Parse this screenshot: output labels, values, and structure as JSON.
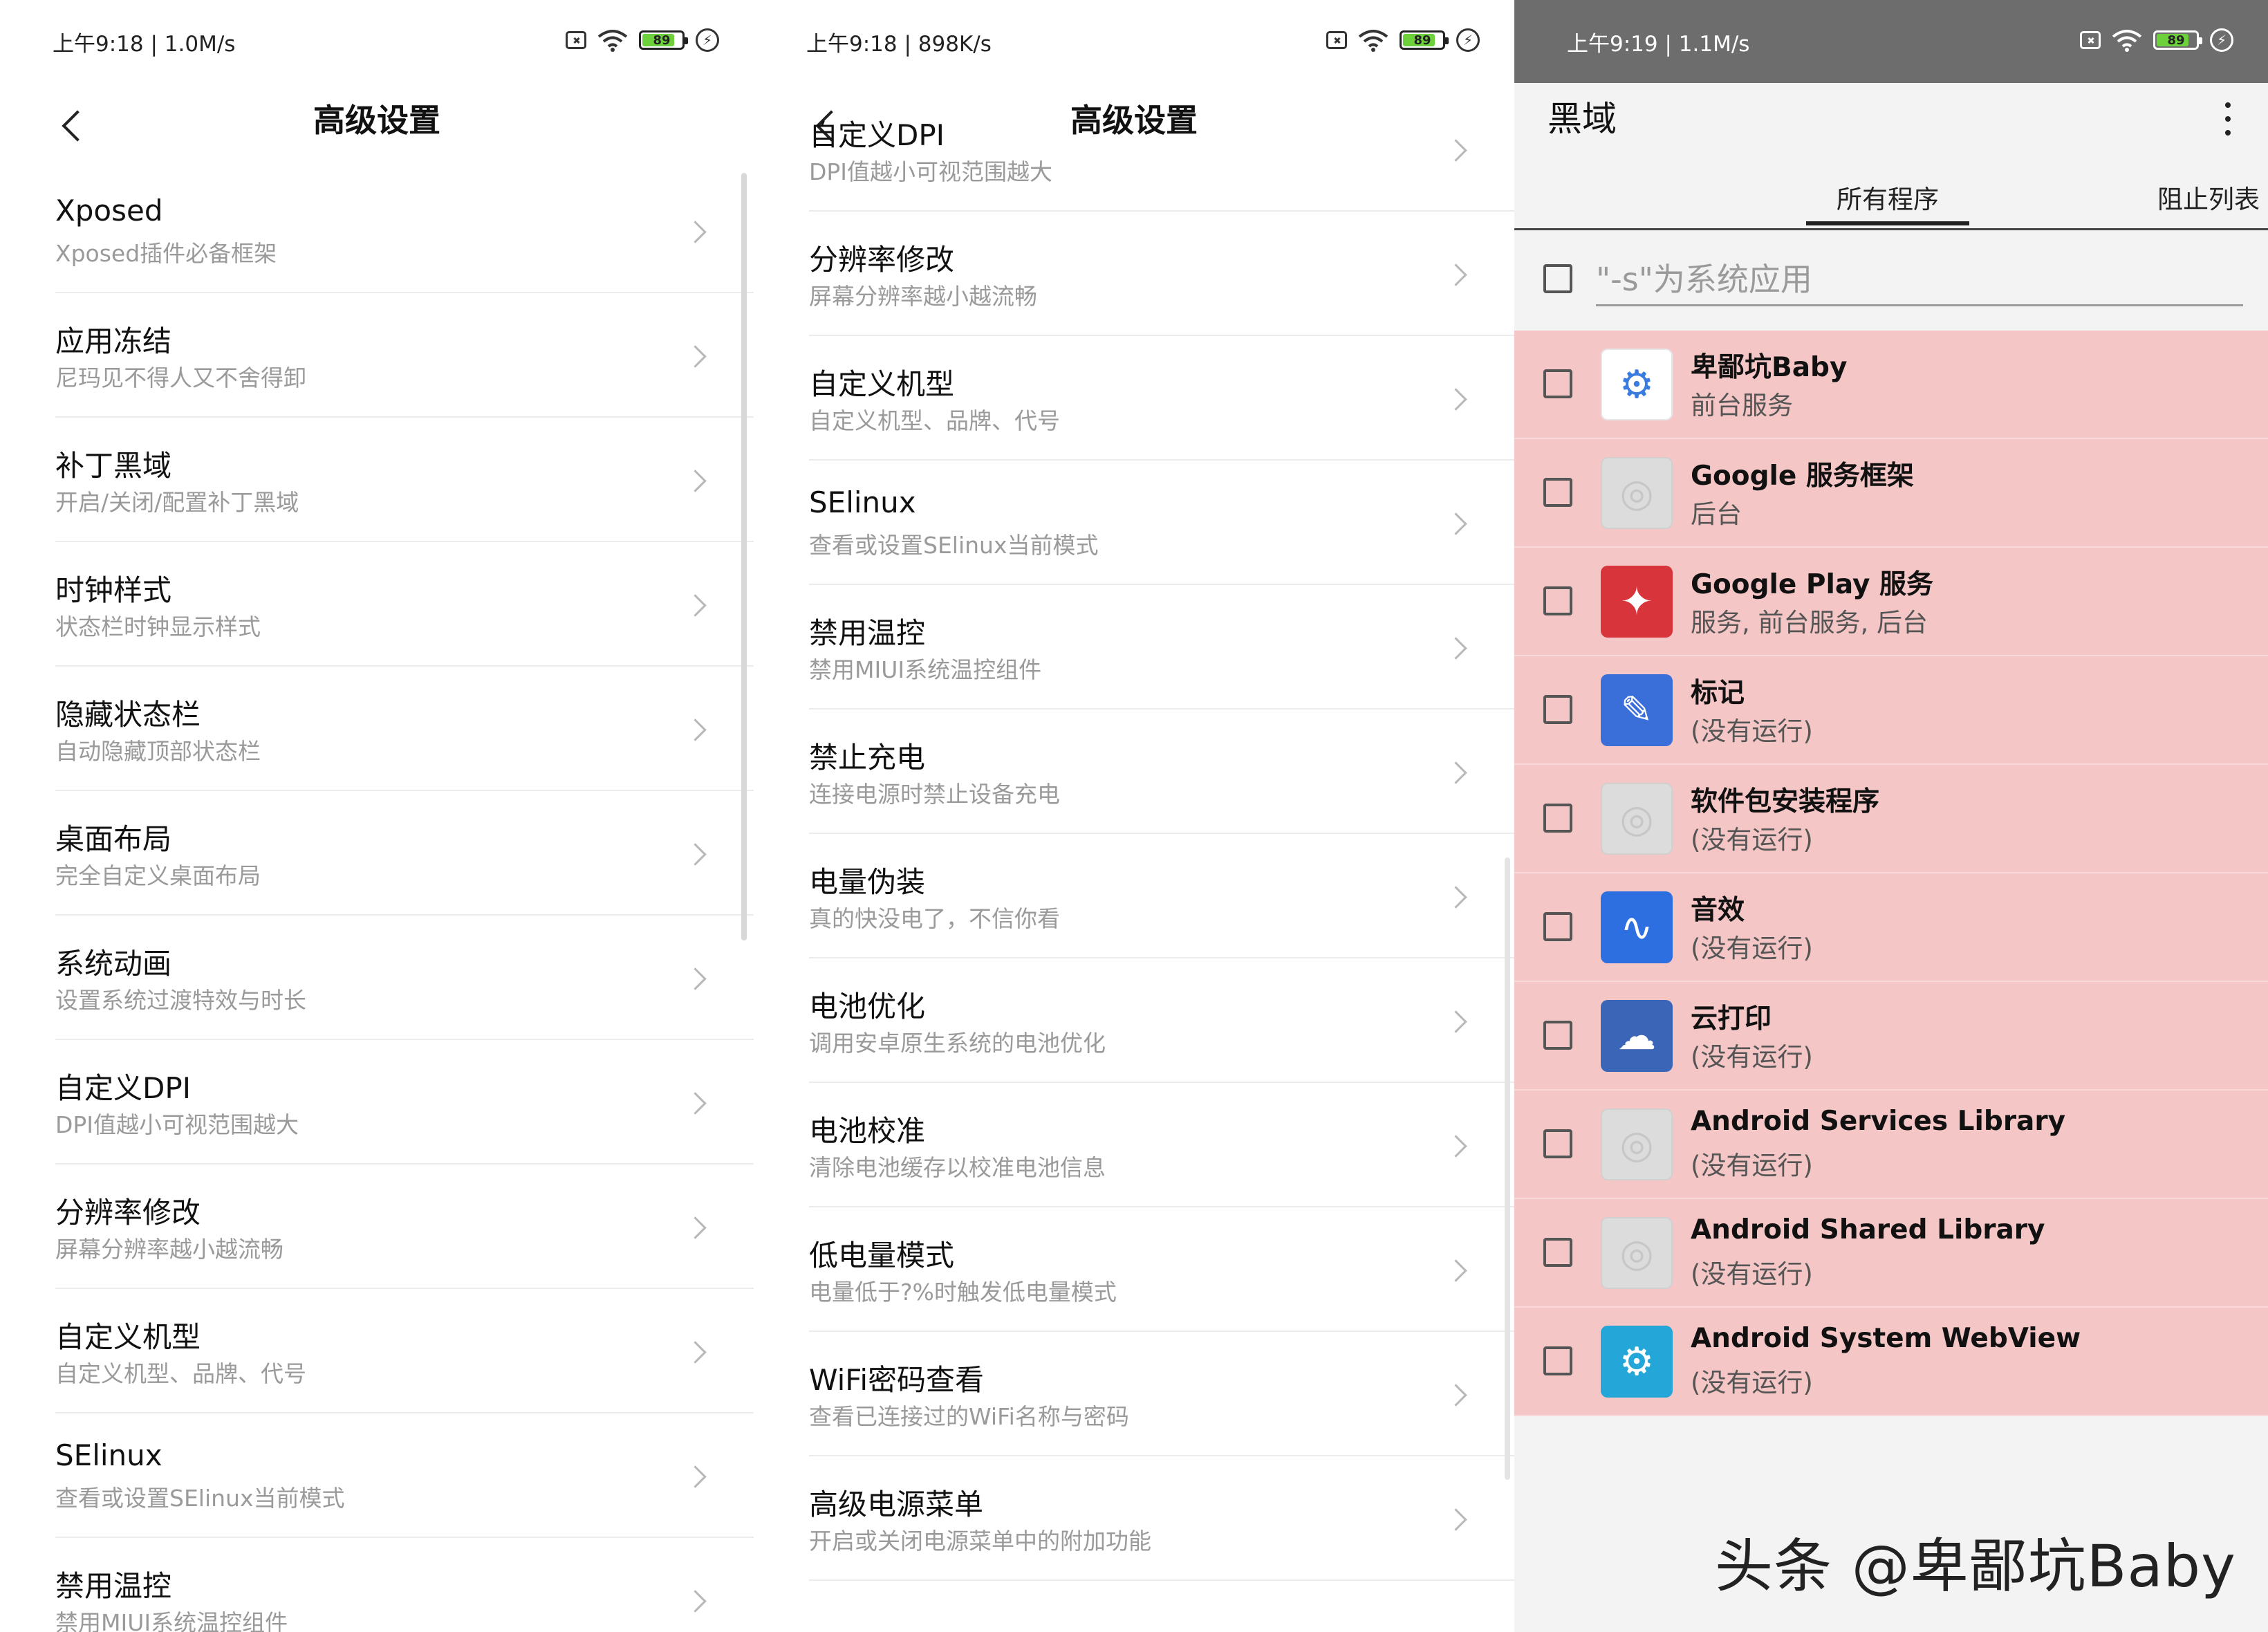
{
  "colors": {
    "accent": "#6cd13a",
    "highlight_rows": "#f4c6c6",
    "subtitle": "#9a9a9a"
  },
  "panel1": {
    "status": {
      "time": "上午9:18 | 1.0M/s",
      "battery": "89"
    },
    "title": "高级设置",
    "items": [
      {
        "title": "Xposed",
        "subtitle": "Xposed插件必备框架"
      },
      {
        "title": "应用冻结",
        "subtitle": "尼玛见不得人又不舍得卸"
      },
      {
        "title": "补丁黑域",
        "subtitle": "开启/关闭/配置补丁黑域"
      },
      {
        "title": "时钟样式",
        "subtitle": "状态栏时钟显示样式"
      },
      {
        "title": "隐藏状态栏",
        "subtitle": "自动隐藏顶部状态栏"
      },
      {
        "title": "桌面布局",
        "subtitle": "完全自定义桌面布局"
      },
      {
        "title": "系统动画",
        "subtitle": "设置系统过渡特效与时长"
      },
      {
        "title": "自定义DPI",
        "subtitle": "DPI值越小可视范围越大"
      },
      {
        "title": "分辨率修改",
        "subtitle": "屏幕分辨率越小越流畅"
      },
      {
        "title": "自定义机型",
        "subtitle": "自定义机型、品牌、代号"
      },
      {
        "title": "SElinux",
        "subtitle": "查看或设置SElinux当前模式"
      },
      {
        "title": "禁用温控",
        "subtitle": "禁用MIUI系统温控组件"
      }
    ]
  },
  "panel2": {
    "status": {
      "time": "上午9:18 | 898K/s",
      "battery": "89"
    },
    "title": "高级设置",
    "items": [
      {
        "title": "自定义DPI",
        "subtitle": "DPI值越小可视范围越大"
      },
      {
        "title": "分辨率修改",
        "subtitle": "屏幕分辨率越小越流畅"
      },
      {
        "title": "自定义机型",
        "subtitle": "自定义机型、品牌、代号"
      },
      {
        "title": "SElinux",
        "subtitle": "查看或设置SElinux当前模式"
      },
      {
        "title": "禁用温控",
        "subtitle": "禁用MIUI系统温控组件"
      },
      {
        "title": "禁止充电",
        "subtitle": "连接电源时禁止设备充电"
      },
      {
        "title": "电量伪装",
        "subtitle": "真的快没电了，不信你看"
      },
      {
        "title": "电池优化",
        "subtitle": "调用安卓原生系统的电池优化"
      },
      {
        "title": "电池校准",
        "subtitle": "清除电池缓存以校准电池信息"
      },
      {
        "title": "低电量模式",
        "subtitle": "电量低于?%时触发低电量模式"
      },
      {
        "title": "WiFi密码查看",
        "subtitle": "查看已连接过的WiFi名称与密码"
      },
      {
        "title": "高级电源菜单",
        "subtitle": "开启或关闭电源菜单中的附加功能"
      }
    ]
  },
  "panel3": {
    "status": {
      "time": "上午9:19 | 1.1M/s",
      "battery": "89"
    },
    "title": "黑域",
    "tabs": [
      "所有程序",
      "阻止列表"
    ],
    "filter_placeholder": "\"-s\"为系统应用",
    "apps": [
      {
        "name": "卑鄙坑Baby",
        "status": "前台服务",
        "icon": "gear-icon"
      },
      {
        "name": "Google 服务框架",
        "status": "后台",
        "icon": "placeholder-icon"
      },
      {
        "name": "Google Play 服务",
        "status": "服务, 前台服务, 后台",
        "icon": "puzzle-icon"
      },
      {
        "name": "标记",
        "status": "(没有运行)",
        "icon": "pen-icon"
      },
      {
        "name": "软件包安装程序",
        "status": "(没有运行)",
        "icon": "placeholder-icon"
      },
      {
        "name": "音效",
        "status": "(没有运行)",
        "icon": "waveform-icon"
      },
      {
        "name": "云打印",
        "status": "(没有运行)",
        "icon": "cloud-print-icon"
      },
      {
        "name": "Android Services Library",
        "status": "(没有运行)",
        "icon": "placeholder-icon"
      },
      {
        "name": "Android Shared Library",
        "status": "(没有运行)",
        "icon": "placeholder-icon"
      },
      {
        "name": "Android System WebView",
        "status": "(没有运行)",
        "icon": "gear-icon"
      }
    ]
  },
  "watermark": "头条 @卑鄙坑Baby"
}
